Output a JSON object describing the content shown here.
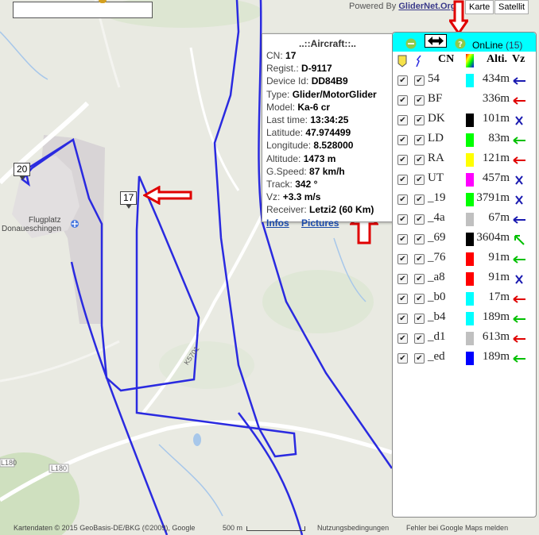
{
  "powered_by": {
    "prefix": "Powered By",
    "link": "GliderNet.Org"
  },
  "map_types": [
    "Karte",
    "Satellit"
  ],
  "map_labels": {
    "aircraft_label_20": "20",
    "aircraft_label_17": "17",
    "airfield_line1": "Flugplatz",
    "airfield_line2": "Donaueschingen",
    "road_k5701": "K5701",
    "road_l180_a": "L180",
    "road_l180_b": "L180"
  },
  "info_window": {
    "title": "..::Aircraft::..",
    "rows": [
      {
        "label": "CN:",
        "value": "17"
      },
      {
        "label": "Regist.:",
        "value": "D-9117"
      },
      {
        "label": "Device Id:",
        "value": "DD84B9"
      },
      {
        "label": "Type:",
        "value": "Glider/MotorGlider"
      },
      {
        "label": "Model:",
        "value": "Ka-6 cr"
      },
      {
        "label": "Last time:",
        "value": "13:34:25"
      },
      {
        "label": "Latitude:",
        "value": "47.974499"
      },
      {
        "label": "Longitude:",
        "value": "8.528000"
      },
      {
        "label": "Altitude:",
        "value": "1473 m"
      },
      {
        "label": "G.Speed:",
        "value": "87 km/h"
      },
      {
        "label": "Track:",
        "value": "342 °"
      },
      {
        "label": "Vz:",
        "value": "+3.3 m/s"
      },
      {
        "label": "Receiver:",
        "value": "Letzi2 (60 Km)"
      }
    ],
    "links": [
      "Infos",
      "Pictures"
    ]
  },
  "panel": {
    "online_label": "OnLine",
    "online_count": "(15)",
    "col_cn": "CN",
    "col_alti": "Alti.",
    "col_vz": "Vz",
    "rows": [
      {
        "cn": "54",
        "color": "#00ffff",
        "alt": "434m",
        "vz": "arrow-left",
        "vzcolor": "#1a1ab0"
      },
      {
        "cn": "BF",
        "color": "#ffffff",
        "alt": "336m",
        "vz": "arrow-left",
        "vzcolor": "#e00000"
      },
      {
        "cn": "DK",
        "color": "#000000",
        "alt": "101m",
        "vz": "x",
        "vzcolor": "#1a1ab0"
      },
      {
        "cn": "LD",
        "color": "#00ff00",
        "alt": "83m",
        "vz": "arrow-left",
        "vzcolor": "#00c000"
      },
      {
        "cn": "RA",
        "color": "#ffff00",
        "alt": "121m",
        "vz": "arrow-left",
        "vzcolor": "#e00000"
      },
      {
        "cn": "UT",
        "color": "#ff00ff",
        "alt": "457m",
        "vz": "x",
        "vzcolor": "#1a1ab0"
      },
      {
        "cn": "_19",
        "color": "#00ff00",
        "alt": "3791m",
        "vz": "x",
        "vzcolor": "#1a1ab0"
      },
      {
        "cn": "_4a",
        "color": "#c0c0c0",
        "alt": "67m",
        "vz": "arrow-left",
        "vzcolor": "#1a1ab0"
      },
      {
        "cn": "_69",
        "color": "#000000",
        "alt": "3604m",
        "vz": "arrow-upleft",
        "vzcolor": "#00c000"
      },
      {
        "cn": "_76",
        "color": "#ff0000",
        "alt": "91m",
        "vz": "arrow-left",
        "vzcolor": "#00c000"
      },
      {
        "cn": "_a8",
        "color": "#ff0000",
        "alt": "91m",
        "vz": "x",
        "vzcolor": "#1a1ab0"
      },
      {
        "cn": "_b0",
        "color": "#00ffff",
        "alt": "17m",
        "vz": "arrow-left",
        "vzcolor": "#e00000"
      },
      {
        "cn": "_b4",
        "color": "#00ffff",
        "alt": "189m",
        "vz": "arrow-left",
        "vzcolor": "#00c000"
      },
      {
        "cn": "_d1",
        "color": "#c0c0c0",
        "alt": "613m",
        "vz": "arrow-left",
        "vzcolor": "#e00000"
      },
      {
        "cn": "_ed",
        "color": "#0000ff",
        "alt": "189m",
        "vz": "arrow-left",
        "vzcolor": "#00c000"
      }
    ]
  },
  "footer": {
    "attribution": "Kartendaten © 2015 GeoBasis-DE/BKG (©2009), Google",
    "scale": "500 m",
    "terms": "Nutzungsbedingungen",
    "report": "Fehler bei Google Maps melden"
  },
  "colors": {
    "track": "#2a2ae0",
    "annotation_arrow": "#e00000",
    "panel_header": "#00ffff"
  }
}
